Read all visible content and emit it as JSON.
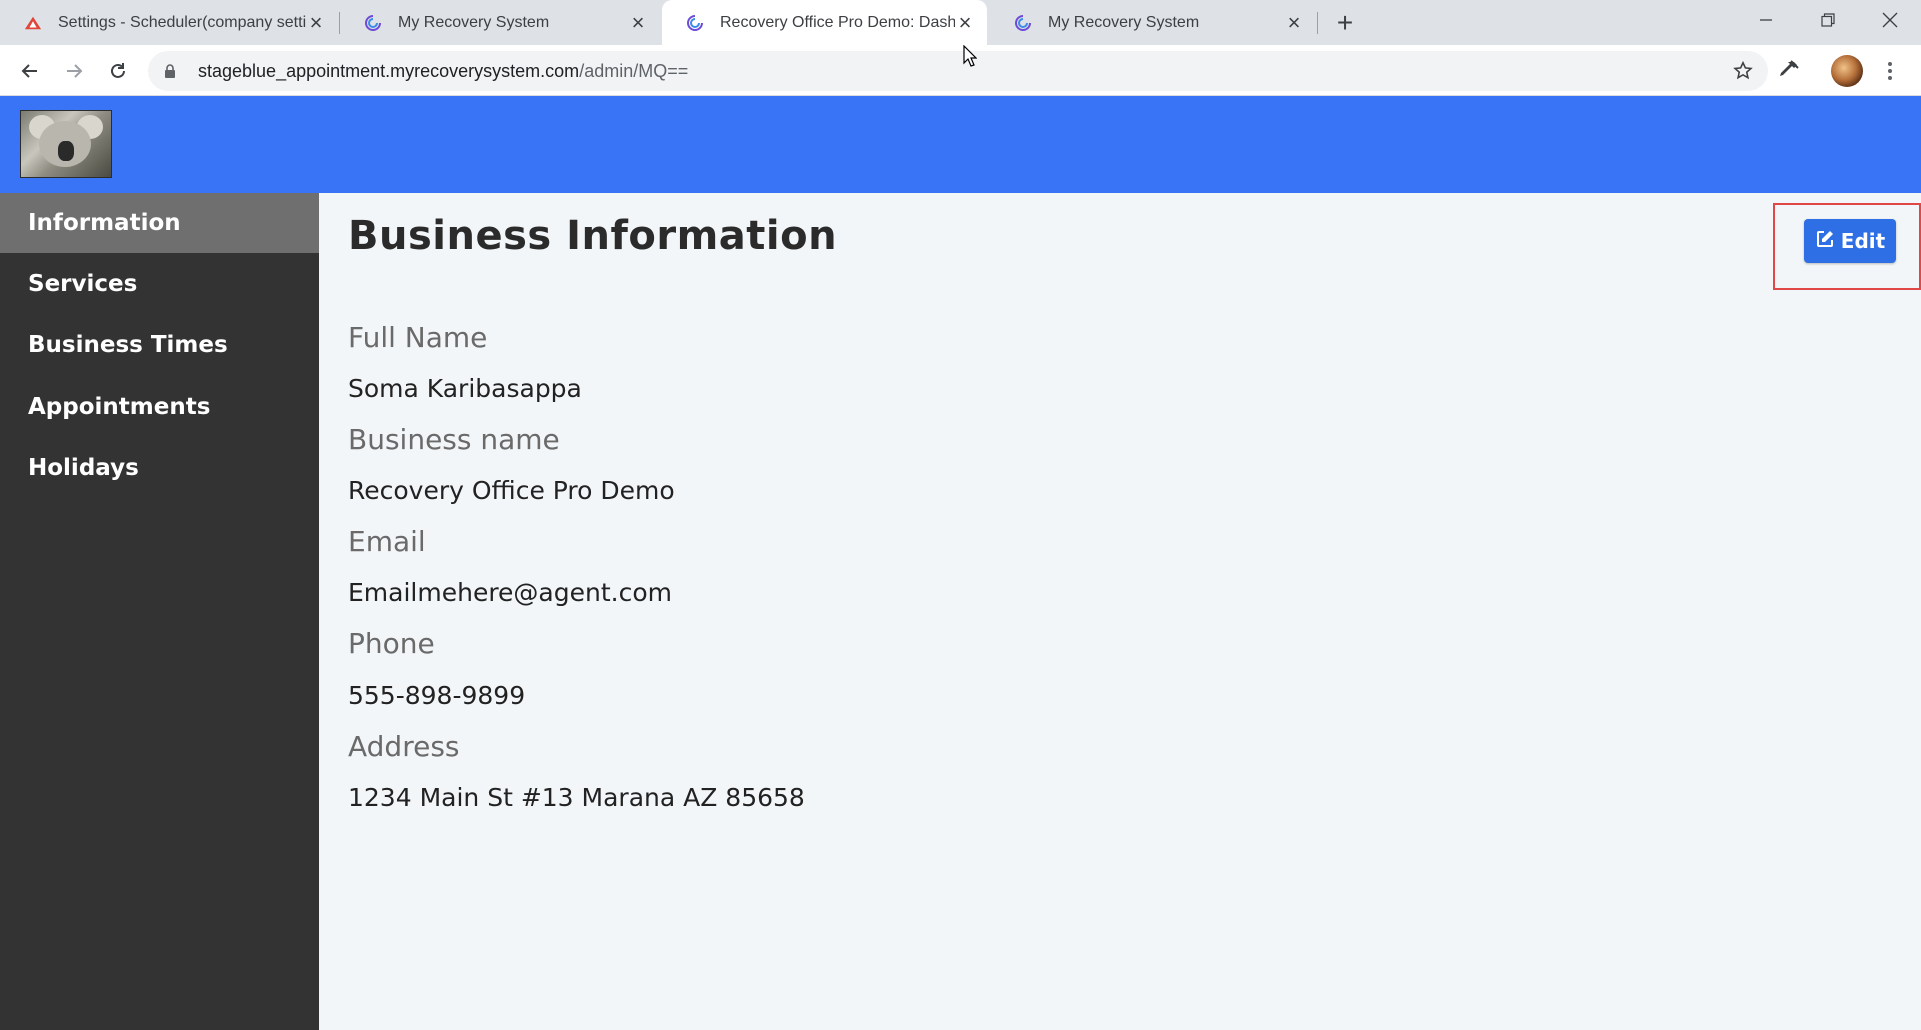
{
  "browser": {
    "tabs": [
      {
        "title": "Settings - Scheduler(company settin",
        "icon": "red-triangle-icon",
        "active": false
      },
      {
        "title": "My Recovery System",
        "icon": "spiral-icon",
        "active": false
      },
      {
        "title": "Recovery Office Pro Demo: Dashboa",
        "icon": "spiral-icon",
        "active": true
      },
      {
        "title": "My Recovery System",
        "icon": "spiral-icon",
        "active": false
      }
    ],
    "url_host": "stageblue_appointment.myrecoverysystem.com",
    "url_path": "/admin/MQ=="
  },
  "sidebar": {
    "items": [
      {
        "label": "Information",
        "active": true
      },
      {
        "label": "Services",
        "active": false
      },
      {
        "label": "Business Times",
        "active": false
      },
      {
        "label": "Appointments",
        "active": false
      },
      {
        "label": "Holidays",
        "active": false
      }
    ]
  },
  "main": {
    "title": "Business Information",
    "edit_label": "Edit",
    "fields": [
      {
        "label": "Full Name",
        "value": "Soma Karibasappa"
      },
      {
        "label": "Business name",
        "value": "Recovery Office Pro Demo"
      },
      {
        "label": "Email",
        "value": "Emailmehere@agent.com"
      },
      {
        "label": "Phone",
        "value": "555-898-9899"
      },
      {
        "label": "Address",
        "value": "1234 Main St #13 Marana AZ 85658"
      }
    ]
  },
  "colors": {
    "header_blue": "#3874f5",
    "sidebar_bg": "#333333",
    "sidebar_active": "#6f6f6f",
    "edit_button": "#2f6fe6",
    "highlight": "#e04848"
  }
}
